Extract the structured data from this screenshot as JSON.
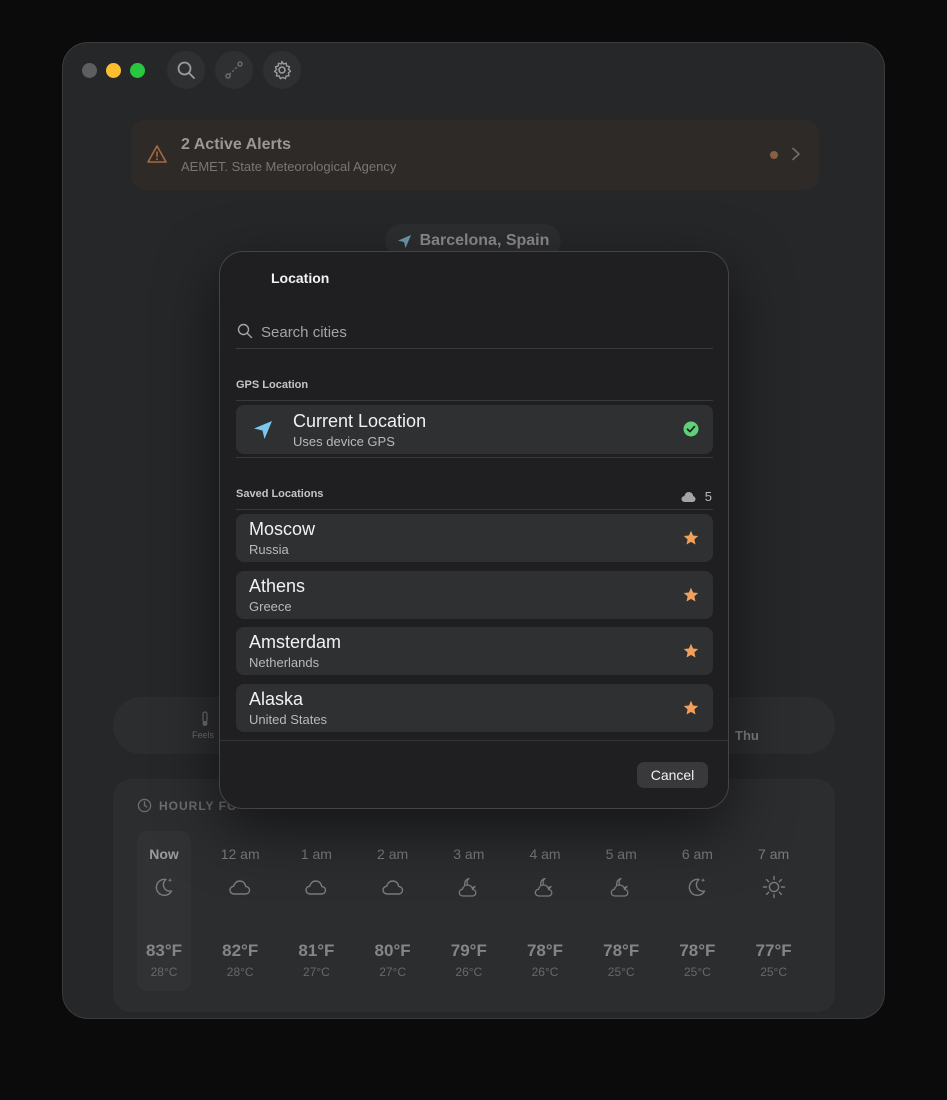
{
  "alert": {
    "title": "2 Active Alerts",
    "source": "AEMET. State Meteorological Agency"
  },
  "location_pill": "Barcelona, Spain",
  "metrics": {
    "feels_label": "Feels",
    "day_label": "Thu"
  },
  "hourly": {
    "header": "HOURLY FO",
    "hours": [
      {
        "label": "Now",
        "icon": "moon-stars-icon",
        "f": "83°F",
        "c": "28°C"
      },
      {
        "label": "12 am",
        "icon": "cloud-icon",
        "f": "82°F",
        "c": "28°C"
      },
      {
        "label": "1 am",
        "icon": "cloud-icon",
        "f": "81°F",
        "c": "27°C"
      },
      {
        "label": "2 am",
        "icon": "cloud-icon",
        "f": "80°F",
        "c": "27°C"
      },
      {
        "label": "3 am",
        "icon": "cloud-moon-icon",
        "f": "79°F",
        "c": "26°C"
      },
      {
        "label": "4 am",
        "icon": "cloud-moon-icon",
        "f": "78°F",
        "c": "26°C"
      },
      {
        "label": "5 am",
        "icon": "cloud-moon-icon",
        "f": "78°F",
        "c": "25°C"
      },
      {
        "label": "6 am",
        "icon": "moon-stars-icon",
        "f": "78°F",
        "c": "25°C"
      },
      {
        "label": "7 am",
        "icon": "sun-icon",
        "f": "77°F",
        "c": "25°C"
      }
    ]
  },
  "sheet": {
    "title": "Location",
    "search_placeholder": "Search cities",
    "gps_section": "GPS Location",
    "gps": {
      "title": "Current Location",
      "subtitle": "Uses device GPS"
    },
    "saved_section": "Saved Locations",
    "saved_count": "5",
    "cities": [
      {
        "name": "Moscow",
        "country": "Russia"
      },
      {
        "name": "Athens",
        "country": "Greece"
      },
      {
        "name": "Amsterdam",
        "country": "Netherlands"
      },
      {
        "name": "Alaska",
        "country": "United States"
      }
    ],
    "cancel_label": "Cancel"
  },
  "colors": {
    "accent_star": "#f0a05a",
    "gps_arrow": "#7cc7ef",
    "check_green": "#5fd07a",
    "traffic_yellow": "#fdbd2e",
    "traffic_green": "#27c840"
  }
}
